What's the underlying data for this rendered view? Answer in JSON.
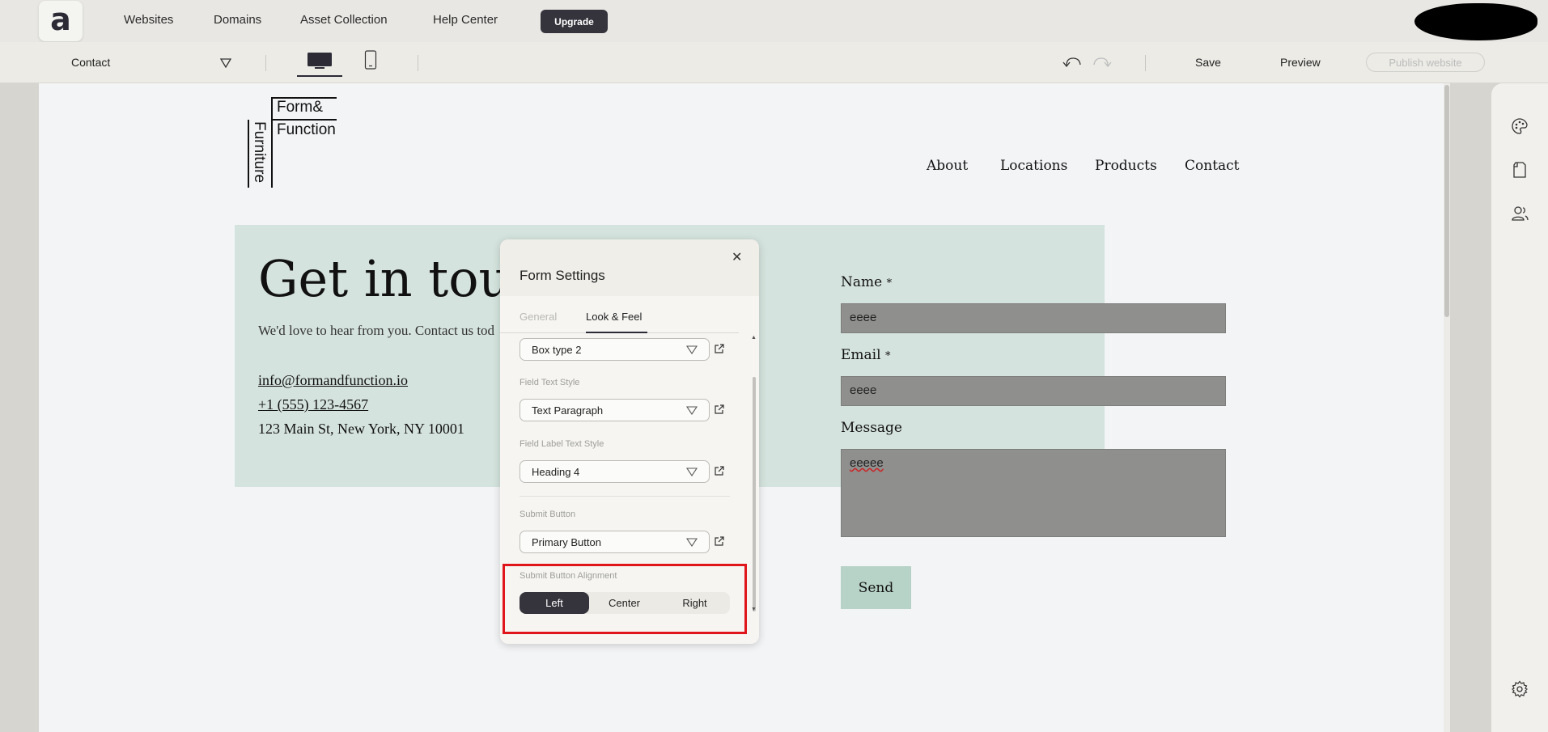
{
  "topnav": {
    "logo_glyph": "a",
    "links": [
      "Websites",
      "Domains",
      "Asset Collection",
      "Help Center"
    ],
    "upgrade_label": "Upgrade"
  },
  "toolbar": {
    "page_selected": "Contact",
    "save_label": "Save",
    "preview_label": "Preview",
    "publish_label": "Publish website"
  },
  "site": {
    "logo": {
      "line1": "Form&",
      "line2": "Function",
      "vertical": "Furniture"
    },
    "nav": [
      "About",
      "Locations",
      "Products",
      "Contact"
    ],
    "hero_title": "Get in touc",
    "hero_subtitle": "We'd love to hear from you. Contact us tod",
    "email": "info@formandfunction.io",
    "phone": "+1 (555) 123-4567",
    "address": "123 Main St, New York, NY 10001",
    "form": {
      "name_label": "Name",
      "email_label": "Email",
      "message_label": "Message",
      "required_mark": "*",
      "name_value": "eeee",
      "email_value": "eeee",
      "message_value": "eeeee",
      "send_label": "Send"
    }
  },
  "panel": {
    "title": "Form Settings",
    "tabs": [
      "General",
      "Look & Feel"
    ],
    "active_tab": "Look & Feel",
    "box_type_value": "Box type 2",
    "field_text_style_label": "Field Text Style",
    "field_text_style_value": "Text Paragraph",
    "field_label_text_style_label": "Field Label Text Style",
    "field_label_text_style_value": "Heading 4",
    "submit_button_label": "Submit Button",
    "submit_button_value": "Primary Button",
    "alignment_label": "Submit Button Alignment",
    "alignment_options": [
      "Left",
      "Center",
      "Right"
    ],
    "alignment_selected": "Left"
  },
  "colors": {
    "accent_dark": "#35343d",
    "hero_bg": "#d5e3de",
    "field_bg": "#8f8f8e",
    "send_bg": "#b7d2c7",
    "highlight": "#e0151b"
  }
}
